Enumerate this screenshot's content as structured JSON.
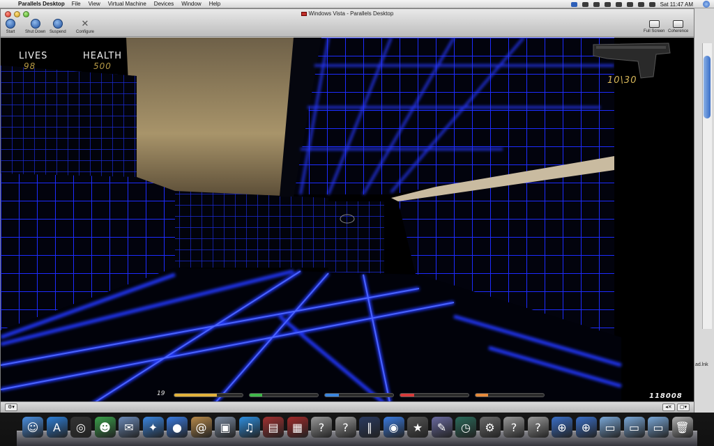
{
  "menubar": {
    "app_name": "Parallels Desktop",
    "items": [
      "File",
      "View",
      "Virtual Machine",
      "Devices",
      "Window",
      "Help"
    ],
    "clock": "Sat 11:47 AM"
  },
  "window": {
    "title": "Windows Vista - Parallels Desktop",
    "toolbar": {
      "start": "Start",
      "shutdown": "Shut Down",
      "suspend": "Suspend",
      "configure": "Configure",
      "fullscreen": "Full Screen",
      "coherence": "Coherence"
    }
  },
  "game_hud": {
    "lives_label": "LIVES",
    "lives_value": "98",
    "health_label": "HEALTH",
    "health_value": "500",
    "ammo": "10\\30",
    "level": "19",
    "score": "118008",
    "bars": [
      {
        "color": "#e3b23a",
        "fill": 0.62
      },
      {
        "color": "#3fb84a",
        "fill": 0.18
      },
      {
        "color": "#3a86e0",
        "fill": 0.2
      },
      {
        "color": "#d83a3a",
        "fill": 0.2
      },
      {
        "color": "#e88a3a",
        "fill": 0.18
      }
    ]
  },
  "desktop": {
    "partial_file_label": "ad.lnk"
  },
  "dock": {
    "items": [
      {
        "name": "finder-icon",
        "color": "#4a8fe0",
        "glyph": "☺"
      },
      {
        "name": "app-store-icon",
        "color": "#2d7fd8",
        "glyph": "A"
      },
      {
        "name": "dashboard-icon",
        "color": "#333333",
        "glyph": "◎"
      },
      {
        "name": "messenger-icon",
        "color": "#3aa04a",
        "glyph": "☻"
      },
      {
        "name": "mail-stamp-icon",
        "color": "#6b8ab8",
        "glyph": "✉"
      },
      {
        "name": "safari-icon",
        "color": "#3a86e0",
        "glyph": "✦"
      },
      {
        "name": "ichat-icon",
        "color": "#3a7be0",
        "glyph": "●"
      },
      {
        "name": "address-book-icon",
        "color": "#b88a4a",
        "glyph": "@"
      },
      {
        "name": "iphoto-icon",
        "color": "#7a8aa0",
        "glyph": "▣"
      },
      {
        "name": "itunes-icon",
        "color": "#2d8fe0",
        "glyph": "♫"
      },
      {
        "name": "photo-booth-icon",
        "color": "#a03030",
        "glyph": "▤"
      },
      {
        "name": "slideshow-icon",
        "color": "#a02a2a",
        "glyph": "▦"
      },
      {
        "name": "unknown-app-icon",
        "color": "#999999",
        "glyph": "?"
      },
      {
        "name": "unknown-app-icon",
        "color": "#999999",
        "glyph": "?"
      },
      {
        "name": "parallels-icon",
        "color": "#2a3a60",
        "glyph": "∥"
      },
      {
        "name": "dvd-player-icon",
        "color": "#3a7be0",
        "glyph": "◉"
      },
      {
        "name": "imovie-icon",
        "color": "#555555",
        "glyph": "★"
      },
      {
        "name": "pen-tool-icon",
        "color": "#6a6aa0",
        "glyph": "✎"
      },
      {
        "name": "time-machine-icon",
        "color": "#2a6a5a",
        "glyph": "◷"
      },
      {
        "name": "system-preferences-icon",
        "color": "#6a6a6a",
        "glyph": "⚙"
      },
      {
        "name": "unknown-app-icon",
        "color": "#999999",
        "glyph": "?"
      },
      {
        "name": "unknown-app-icon",
        "color": "#999999",
        "glyph": "?"
      },
      {
        "name": "parallels-vm-icon",
        "color": "#3a6fc8",
        "glyph": "⊕"
      },
      {
        "name": "parallels-vm-icon",
        "color": "#3a6fc8",
        "glyph": "⊕"
      },
      {
        "name": "applications-folder-icon",
        "color": "#7aa8d8",
        "glyph": "▭"
      },
      {
        "name": "documents-folder-icon",
        "color": "#7aa8d8",
        "glyph": "▭"
      },
      {
        "name": "downloads-folder-icon",
        "color": "#7aa8d8",
        "glyph": "▭"
      },
      {
        "name": "trash-icon",
        "color": "#b0b0b0",
        "glyph": "🗑"
      }
    ]
  }
}
